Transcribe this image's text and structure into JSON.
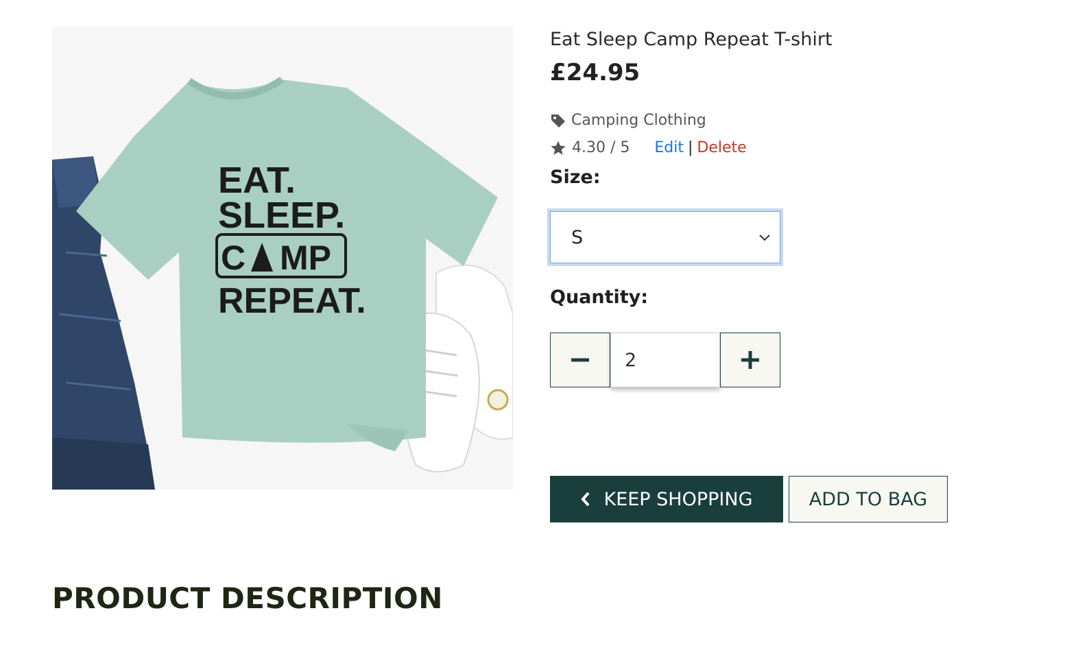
{
  "product": {
    "title": "Eat Sleep Camp Repeat T-shirt",
    "price": "£24.95",
    "category": "Camping Clothing",
    "rating": "4.30 / 5",
    "edit_label": "Edit",
    "separator": "|",
    "delete_label": "Delete",
    "image_text": {
      "line1": "EAT.",
      "line2": "SLEEP.",
      "line3_left": "C",
      "line3_right": "MP",
      "line4": "REPEAT."
    }
  },
  "size": {
    "label": "Size:",
    "selected": "S"
  },
  "quantity": {
    "label": "Quantity:",
    "value": "2"
  },
  "actions": {
    "keep_shopping": "KEEP SHOPPING",
    "add_to_bag": "ADD TO BAG"
  },
  "description": {
    "heading": "PRODUCT DESCRIPTION"
  },
  "icons": {
    "category": "tag-icon",
    "rating": "star-icon",
    "select": "chevron-down-icon",
    "decrement": "minus-icon",
    "increment": "plus-icon",
    "back": "chevron-left-icon"
  },
  "colors": {
    "primary": "#1a3e3c",
    "edit_link": "#1a73e8",
    "delete_link": "#c0392b",
    "shirt": "#a9cfc2"
  }
}
